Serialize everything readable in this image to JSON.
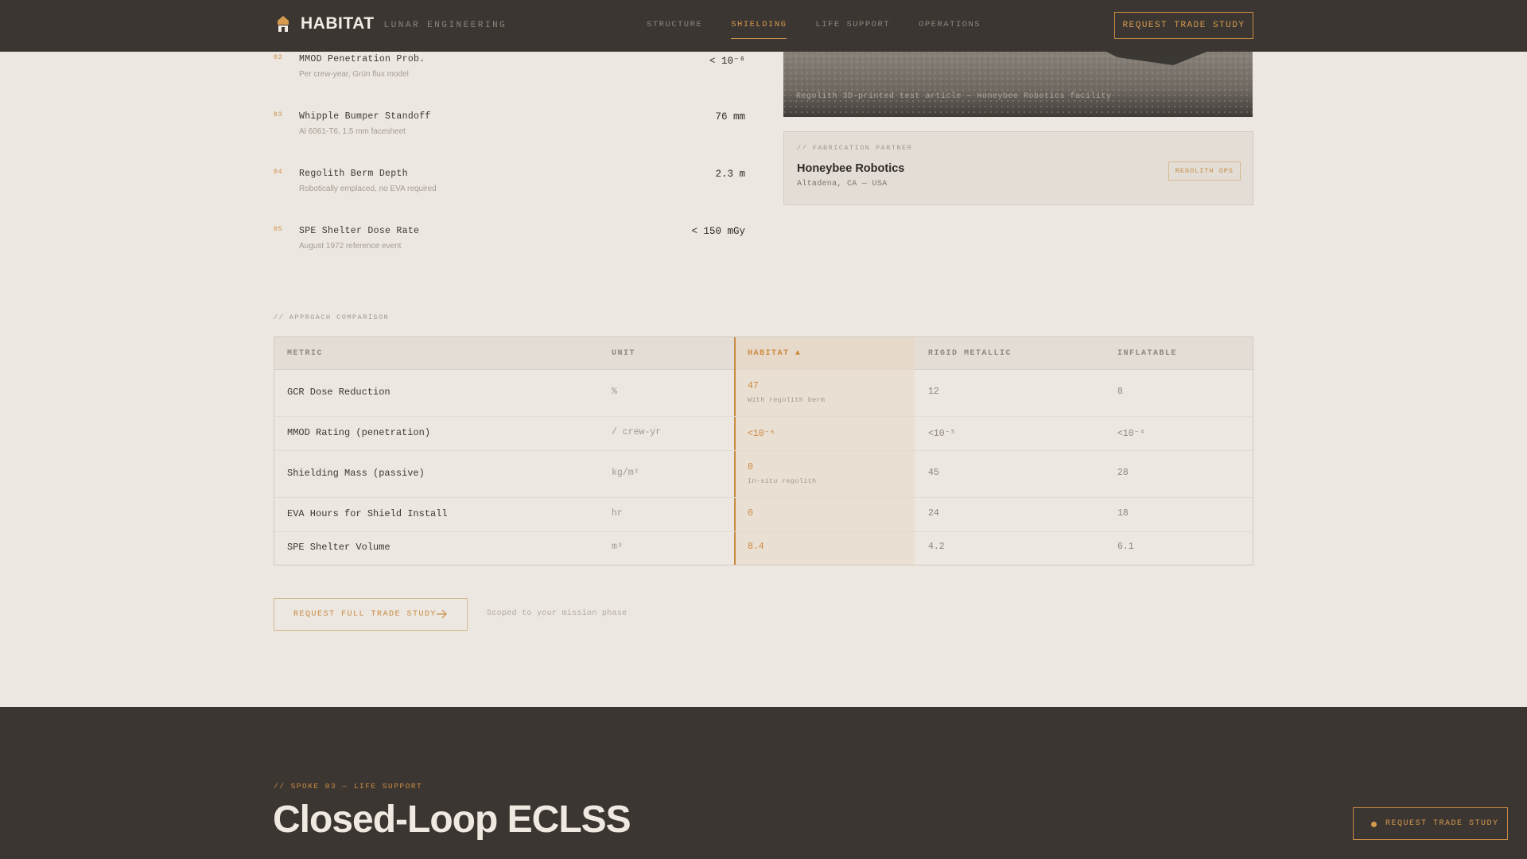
{
  "header": {
    "brand": "HABITAT",
    "brand_sub": "LUNAR ENGINEERING",
    "nav": [
      "STRUCTURE",
      "SHIELDING",
      "LIFE SUPPORT",
      "OPERATIONS"
    ],
    "active_nav": "SHIELDING",
    "cta": "REQUEST TRADE STUDY"
  },
  "specs": [
    {
      "num": "02",
      "title": "MMOD Penetration Prob.",
      "note": "Per crew-year, Grün flux model",
      "value": "< 10⁻⁶"
    },
    {
      "num": "03",
      "title": "Whipple Bumper Standoff",
      "note": "Al 6061-T6, 1.5 mm facesheet",
      "value": "76 mm"
    },
    {
      "num": "04",
      "title": "Regolith Berm Depth",
      "note": "Robotically emplaced, no EVA required",
      "value": "2.3 m"
    },
    {
      "num": "05",
      "title": "SPE Shelter Dose Rate",
      "note": "August 1972 reference event",
      "value": "< 150 mGy"
    }
  ],
  "photo": {
    "caption": "Regolith 3D-printed test article — Honeybee Robotics facility"
  },
  "partner": {
    "label": "// FABRICATION PARTNER",
    "name": "Honeybee Robotics",
    "location": "Altadena, CA — USA",
    "tag": "REGOLITH OPS"
  },
  "comparison": {
    "label": "// APPROACH COMPARISON",
    "headers": [
      "METRIC",
      "UNIT",
      "HABITAT ▲",
      "RIGID METALLIC",
      "INFLATABLE"
    ],
    "rows": [
      {
        "metric": "GCR Dose Reduction",
        "unit": "%",
        "habitat": "47",
        "habitat_note": "With regolith berm",
        "rigid": "12",
        "inflatable": "8"
      },
      {
        "metric": "MMOD Rating (penetration)",
        "unit": "/ crew-yr",
        "habitat": "<10⁻⁶",
        "habitat_note": "",
        "rigid": "<10⁻⁵",
        "inflatable": "<10⁻⁴"
      },
      {
        "metric": "Shielding Mass (passive)",
        "unit": "kg/m²",
        "habitat": "0",
        "habitat_note": "In-situ regolith",
        "rigid": "45",
        "inflatable": "28"
      },
      {
        "metric": "EVA Hours for Shield Install",
        "unit": "hr",
        "habitat": "0",
        "habitat_note": "",
        "rigid": "24",
        "inflatable": "18"
      },
      {
        "metric": "SPE Shelter Volume",
        "unit": "m³",
        "habitat": "8.4",
        "habitat_note": "",
        "rigid": "4.2",
        "inflatable": "6.1"
      }
    ]
  },
  "cta": {
    "label": "REQUEST FULL TRADE STUDY",
    "note": "Scoped to your mission phase"
  },
  "next_section": {
    "eyebrow": "// SPOKE 03 — LIFE SUPPORT",
    "title": "Closed-Loop ECLSS"
  },
  "floating_cta": "REQUEST TRADE STUDY",
  "colors": {
    "accent": "#c98a43",
    "dark": "#3b3632",
    "background": "#ece7e0"
  }
}
